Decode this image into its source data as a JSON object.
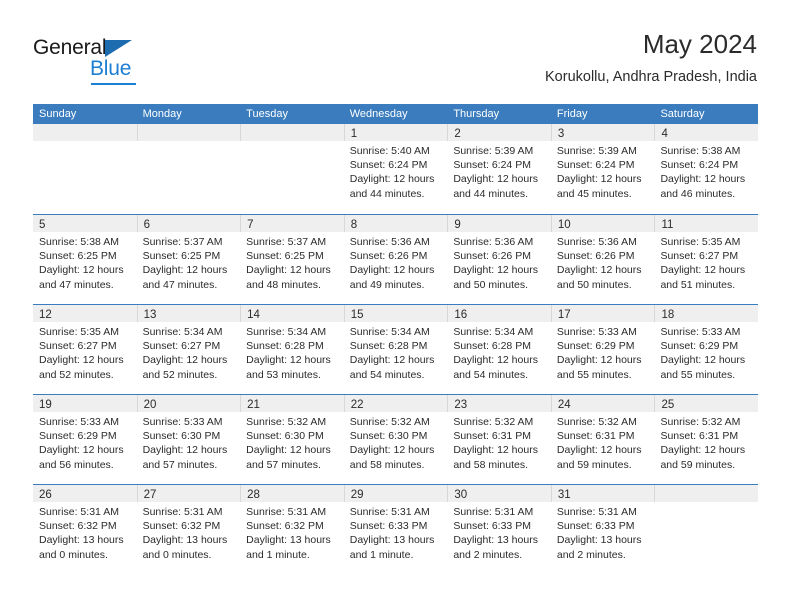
{
  "brand": {
    "name_part1": "General",
    "name_part2": "Blue",
    "triangle_color": "#1d6cb0",
    "blue_color": "#1d7fd4"
  },
  "header": {
    "title": "May 2024",
    "subtitle": "Korukollu, Andhra Pradesh, India"
  },
  "theme": {
    "header_blue": "#3a7cbd",
    "day_band_gray": "#efefef",
    "text_color": "#2b2b2b"
  },
  "weekdays": [
    "Sunday",
    "Monday",
    "Tuesday",
    "Wednesday",
    "Thursday",
    "Friday",
    "Saturday"
  ],
  "weeks": [
    [
      {
        "day": "",
        "lines": []
      },
      {
        "day": "",
        "lines": []
      },
      {
        "day": "",
        "lines": []
      },
      {
        "day": "1",
        "lines": [
          "Sunrise: 5:40 AM",
          "Sunset: 6:24 PM",
          "Daylight: 12 hours",
          "and 44 minutes."
        ]
      },
      {
        "day": "2",
        "lines": [
          "Sunrise: 5:39 AM",
          "Sunset: 6:24 PM",
          "Daylight: 12 hours",
          "and 44 minutes."
        ]
      },
      {
        "day": "3",
        "lines": [
          "Sunrise: 5:39 AM",
          "Sunset: 6:24 PM",
          "Daylight: 12 hours",
          "and 45 minutes."
        ]
      },
      {
        "day": "4",
        "lines": [
          "Sunrise: 5:38 AM",
          "Sunset: 6:24 PM",
          "Daylight: 12 hours",
          "and 46 minutes."
        ]
      }
    ],
    [
      {
        "day": "5",
        "lines": [
          "Sunrise: 5:38 AM",
          "Sunset: 6:25 PM",
          "Daylight: 12 hours",
          "and 47 minutes."
        ]
      },
      {
        "day": "6",
        "lines": [
          "Sunrise: 5:37 AM",
          "Sunset: 6:25 PM",
          "Daylight: 12 hours",
          "and 47 minutes."
        ]
      },
      {
        "day": "7",
        "lines": [
          "Sunrise: 5:37 AM",
          "Sunset: 6:25 PM",
          "Daylight: 12 hours",
          "and 48 minutes."
        ]
      },
      {
        "day": "8",
        "lines": [
          "Sunrise: 5:36 AM",
          "Sunset: 6:26 PM",
          "Daylight: 12 hours",
          "and 49 minutes."
        ]
      },
      {
        "day": "9",
        "lines": [
          "Sunrise: 5:36 AM",
          "Sunset: 6:26 PM",
          "Daylight: 12 hours",
          "and 50 minutes."
        ]
      },
      {
        "day": "10",
        "lines": [
          "Sunrise: 5:36 AM",
          "Sunset: 6:26 PM",
          "Daylight: 12 hours",
          "and 50 minutes."
        ]
      },
      {
        "day": "11",
        "lines": [
          "Sunrise: 5:35 AM",
          "Sunset: 6:27 PM",
          "Daylight: 12 hours",
          "and 51 minutes."
        ]
      }
    ],
    [
      {
        "day": "12",
        "lines": [
          "Sunrise: 5:35 AM",
          "Sunset: 6:27 PM",
          "Daylight: 12 hours",
          "and 52 minutes."
        ]
      },
      {
        "day": "13",
        "lines": [
          "Sunrise: 5:34 AM",
          "Sunset: 6:27 PM",
          "Daylight: 12 hours",
          "and 52 minutes."
        ]
      },
      {
        "day": "14",
        "lines": [
          "Sunrise: 5:34 AM",
          "Sunset: 6:28 PM",
          "Daylight: 12 hours",
          "and 53 minutes."
        ]
      },
      {
        "day": "15",
        "lines": [
          "Sunrise: 5:34 AM",
          "Sunset: 6:28 PM",
          "Daylight: 12 hours",
          "and 54 minutes."
        ]
      },
      {
        "day": "16",
        "lines": [
          "Sunrise: 5:34 AM",
          "Sunset: 6:28 PM",
          "Daylight: 12 hours",
          "and 54 minutes."
        ]
      },
      {
        "day": "17",
        "lines": [
          "Sunrise: 5:33 AM",
          "Sunset: 6:29 PM",
          "Daylight: 12 hours",
          "and 55 minutes."
        ]
      },
      {
        "day": "18",
        "lines": [
          "Sunrise: 5:33 AM",
          "Sunset: 6:29 PM",
          "Daylight: 12 hours",
          "and 55 minutes."
        ]
      }
    ],
    [
      {
        "day": "19",
        "lines": [
          "Sunrise: 5:33 AM",
          "Sunset: 6:29 PM",
          "Daylight: 12 hours",
          "and 56 minutes."
        ]
      },
      {
        "day": "20",
        "lines": [
          "Sunrise: 5:33 AM",
          "Sunset: 6:30 PM",
          "Daylight: 12 hours",
          "and 57 minutes."
        ]
      },
      {
        "day": "21",
        "lines": [
          "Sunrise: 5:32 AM",
          "Sunset: 6:30 PM",
          "Daylight: 12 hours",
          "and 57 minutes."
        ]
      },
      {
        "day": "22",
        "lines": [
          "Sunrise: 5:32 AM",
          "Sunset: 6:30 PM",
          "Daylight: 12 hours",
          "and 58 minutes."
        ]
      },
      {
        "day": "23",
        "lines": [
          "Sunrise: 5:32 AM",
          "Sunset: 6:31 PM",
          "Daylight: 12 hours",
          "and 58 minutes."
        ]
      },
      {
        "day": "24",
        "lines": [
          "Sunrise: 5:32 AM",
          "Sunset: 6:31 PM",
          "Daylight: 12 hours",
          "and 59 minutes."
        ]
      },
      {
        "day": "25",
        "lines": [
          "Sunrise: 5:32 AM",
          "Sunset: 6:31 PM",
          "Daylight: 12 hours",
          "and 59 minutes."
        ]
      }
    ],
    [
      {
        "day": "26",
        "lines": [
          "Sunrise: 5:31 AM",
          "Sunset: 6:32 PM",
          "Daylight: 13 hours",
          "and 0 minutes."
        ]
      },
      {
        "day": "27",
        "lines": [
          "Sunrise: 5:31 AM",
          "Sunset: 6:32 PM",
          "Daylight: 13 hours",
          "and 0 minutes."
        ]
      },
      {
        "day": "28",
        "lines": [
          "Sunrise: 5:31 AM",
          "Sunset: 6:32 PM",
          "Daylight: 13 hours",
          "and 1 minute."
        ]
      },
      {
        "day": "29",
        "lines": [
          "Sunrise: 5:31 AM",
          "Sunset: 6:33 PM",
          "Daylight: 13 hours",
          "and 1 minute."
        ]
      },
      {
        "day": "30",
        "lines": [
          "Sunrise: 5:31 AM",
          "Sunset: 6:33 PM",
          "Daylight: 13 hours",
          "and 2 minutes."
        ]
      },
      {
        "day": "31",
        "lines": [
          "Sunrise: 5:31 AM",
          "Sunset: 6:33 PM",
          "Daylight: 13 hours",
          "and 2 minutes."
        ]
      },
      {
        "day": "",
        "lines": []
      }
    ]
  ]
}
